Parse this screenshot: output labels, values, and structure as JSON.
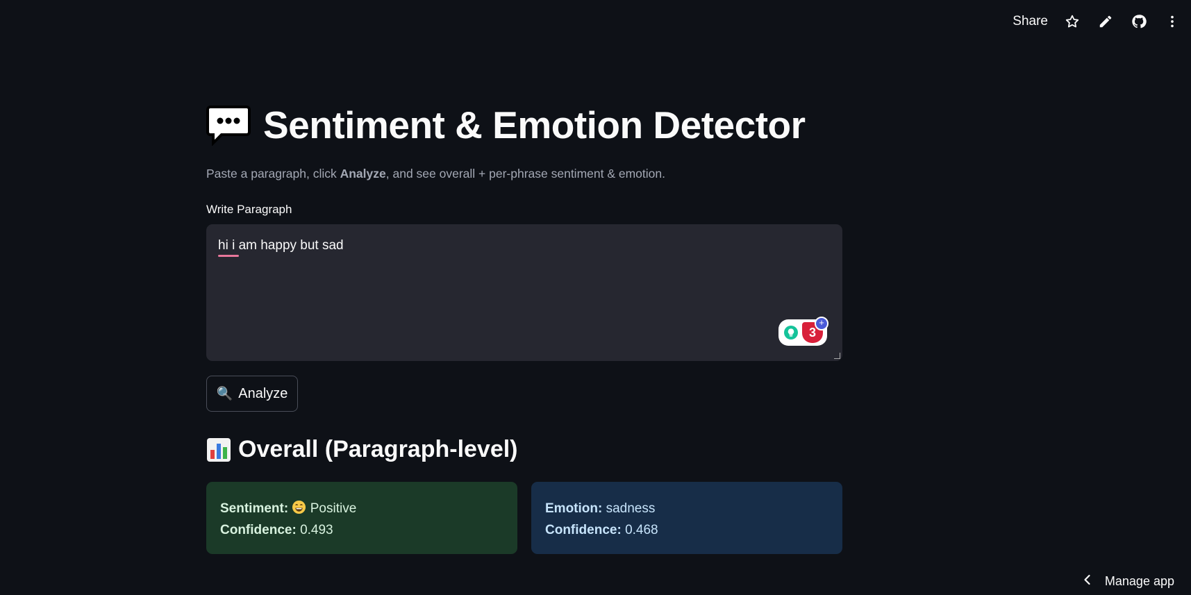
{
  "toolbar": {
    "share_label": "Share",
    "icons": [
      "star-icon",
      "pencil-icon",
      "github-icon",
      "more-vertical-icon"
    ]
  },
  "header": {
    "title": "Sentiment & Emotion Detector",
    "subtitle_prefix": "Paste a paragraph, click ",
    "subtitle_bold": "Analyze",
    "subtitle_suffix": ", and see overall + per-phrase sentiment & emotion."
  },
  "input": {
    "label": "Write Paragraph",
    "value": "hi i am happy but sad",
    "grammar_count": "3"
  },
  "analyze_button": {
    "label": "Analyze"
  },
  "overall": {
    "heading": "Overall (Paragraph-level)",
    "sentiment": {
      "label": "Sentiment:",
      "value": "Positive",
      "confidence_label": "Confidence:",
      "confidence": "0.493",
      "color": "#1b3a28"
    },
    "emotion": {
      "label": "Emotion:",
      "value": "sadness",
      "confidence_label": "Confidence:",
      "confidence": "0.468",
      "color": "#172d48"
    }
  },
  "footer": {
    "manage_label": "Manage app"
  }
}
